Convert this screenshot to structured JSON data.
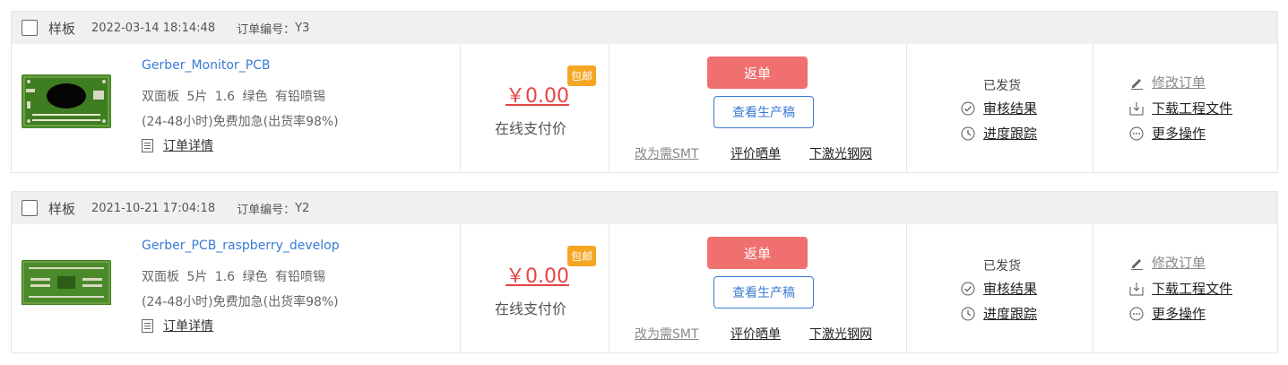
{
  "orders": [
    {
      "type": "样板",
      "datetime": "2022-03-14 18:14:48",
      "order_no_label": "订单编号：",
      "order_no": "Y3",
      "product_name": "Gerber_Monitor_PCB",
      "specs": "双面板  5片  1.6  绿色  有铅喷锡",
      "shipping": "(24-48小时)免费加急(出货率98%)",
      "detail_link": "订单详情",
      "price": "￥0.00",
      "free_ship_tag": "包邮",
      "pay_label": "在线支付价",
      "return_button": "返单",
      "view_button": "查看生产稿",
      "smt_link": "改为需SMT",
      "review_link": "评价晒单",
      "stencil_link": "下激光钢网",
      "status": "已发货",
      "audit_link": "审核结果",
      "progress_link": "进度跟踪",
      "edit_link": "修改订单",
      "download_link": "下载工程文件",
      "more_link": "更多操作"
    },
    {
      "type": "样板",
      "datetime": "2021-10-21 17:04:18",
      "order_no_label": "订单编号：",
      "order_no": "Y2",
      "product_name": "Gerber_PCB_raspberry_develop",
      "specs": "双面板  5片  1.6  绿色  有铅喷锡",
      "shipping": "(24-48小时)免费加急(出货率98%)",
      "detail_link": "订单详情",
      "price": "￥0.00",
      "free_ship_tag": "包邮",
      "pay_label": "在线支付价",
      "return_button": "返单",
      "view_button": "查看生产稿",
      "smt_link": "改为需SMT",
      "review_link": "评价晒单",
      "stencil_link": "下激光钢网",
      "status": "已发货",
      "audit_link": "审核结果",
      "progress_link": "进度跟踪",
      "edit_link": "修改订单",
      "download_link": "下载工程文件",
      "more_link": "更多操作"
    }
  ],
  "colors": {
    "accent_blue": "#3a7bd5",
    "price_red": "#e64545",
    "return_button": "#f07070",
    "tag_orange": "#f5a623",
    "header_bg": "#f0f0f0"
  },
  "icons": {
    "detail": "document-icon",
    "audit": "check-circle-icon",
    "progress": "clock-icon",
    "edit": "pencil-icon",
    "download": "download-icon",
    "more": "ellipsis-circle-icon"
  }
}
